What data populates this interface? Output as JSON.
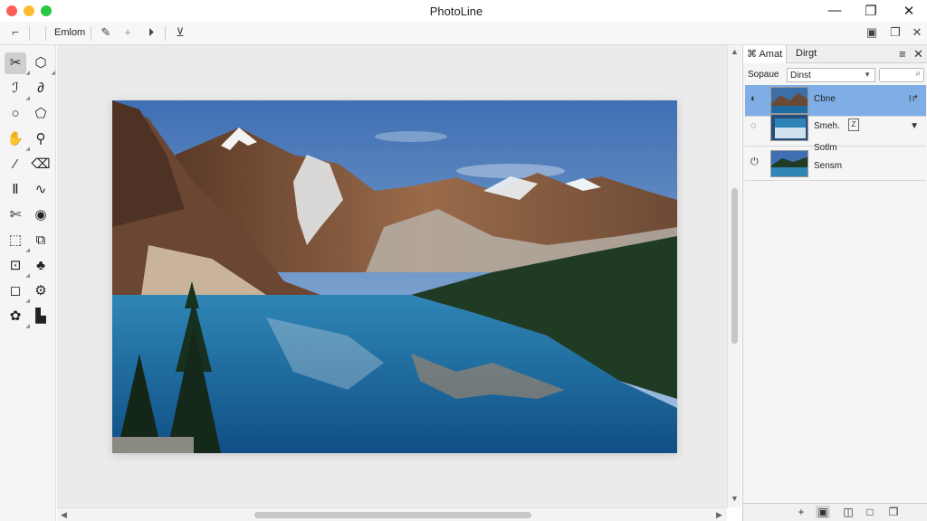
{
  "window": {
    "title": "PhotoLine",
    "controls": {
      "minimize": "—",
      "maximize": "❐",
      "close": "✕"
    },
    "traffic_colors": [
      "#fe5f57",
      "#febc2e",
      "#28c840"
    ]
  },
  "toolbar": {
    "pointer_icon": "cursor-icon",
    "mode_label": "Emlom",
    "items": [
      "pencil-icon",
      "plus-icon",
      "play-icon",
      "stamp-icon"
    ],
    "right_items": [
      "image-icon",
      "copy-icon",
      "close-icon"
    ]
  },
  "tools": [
    "scissors-icon",
    "shapes-icon",
    "lasso-icon",
    "curve-icon",
    "circle-icon",
    "polygon-icon",
    "hand-icon",
    "pipette-icon",
    "brush-icon",
    "eraser-icon",
    "text-icon",
    "path-icon",
    "cut-icon",
    "blur-icon",
    "crop-icon",
    "transform-icon",
    "select-icon",
    "fill-icon",
    "shape-icon",
    "gear-icon",
    "clone-icon",
    "stamp-icon"
  ],
  "panel": {
    "tabs": [
      "Amat",
      "Dirgt"
    ],
    "menu_icon": "≡",
    "close_icon": "✕",
    "filter_label": "Sopaue",
    "filter_value": "Dinst",
    "layers": [
      {
        "name": "Cbne",
        "right": "I↱",
        "selected": true
      },
      {
        "name": "Smeh.",
        "badge": "Z",
        "right": "▼",
        "selected": false
      },
      {
        "name": "Sotlm",
        "name2": "Sensm",
        "selected": false
      }
    ],
    "footer_icons": [
      "add-icon",
      "group-icon",
      "mask-icon",
      "new-layer-icon",
      "duplicate-icon"
    ],
    "footer_glyphs": [
      "+",
      "▣",
      "◫",
      "□",
      "❐"
    ]
  },
  "colors": {
    "selected_layer": "#7eaee5",
    "canvas": "#ebebeb"
  }
}
